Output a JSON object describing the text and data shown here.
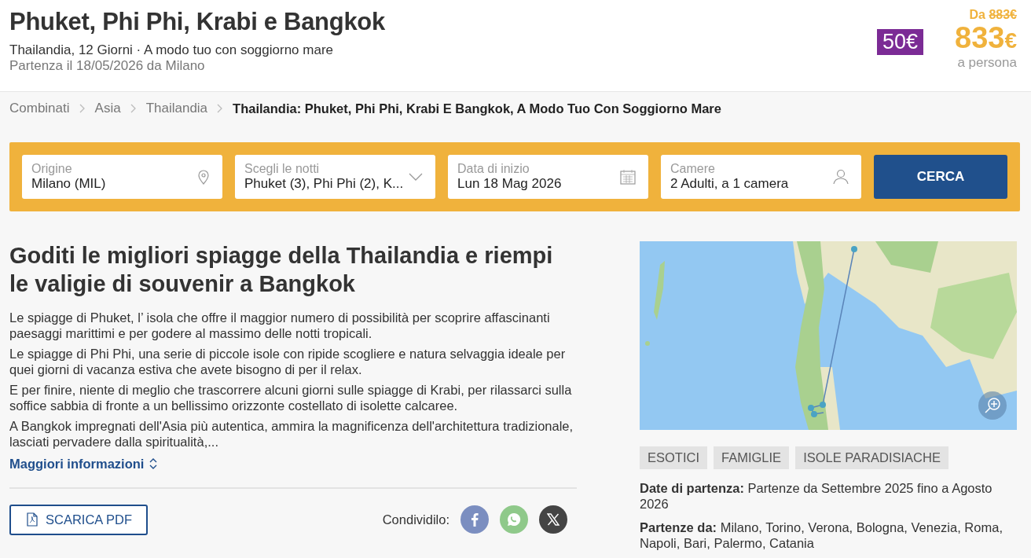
{
  "header": {
    "title": "Phuket, Phi Phi, Krabi e Bangkok",
    "subtitle": "Thailandia, 12 Giorni · A modo tuo con soggiorno mare",
    "departure": "Partenza il 18/05/2026 da Milano",
    "discount": "50€",
    "price_prefix": "Da",
    "old_price": "883€",
    "price": "833",
    "currency": "€",
    "price_note": "a persona"
  },
  "breadcrumb": [
    {
      "label": "Combinati",
      "current": false
    },
    {
      "label": "Asia",
      "current": false
    },
    {
      "label": "Thailandia",
      "current": false
    },
    {
      "label": "Thailandia: Phuket, Phi Phi, Krabi E Bangkok, A Modo Tuo Con Soggiorno Mare",
      "current": true
    }
  ],
  "search": {
    "fields": [
      {
        "label": "Origine",
        "value": "Milano (MIL)",
        "kind": "pin"
      },
      {
        "label": "Scegli le notti",
        "value": "Phuket (3), Phi Phi (2), K...",
        "kind": "dropdown"
      },
      {
        "label": "Data di inizio",
        "value": "Lun 18 Mag 2026",
        "kind": "calendar"
      },
      {
        "label": "Camere",
        "value": "2 Adulti, a 1 camera",
        "kind": "person"
      }
    ],
    "button": "CERCA"
  },
  "article": {
    "heading": "Goditi le migliori spiagge della Thailandia e riempi le valigie di souvenir a Bangkok",
    "paragraphs": [
      "Le spiagge di Phuket, l’ isola che offre il maggior numero di possibilità per scoprire affascinanti paesaggi marittimi e per godere al massimo delle notti tropicali.",
      "Le spiagge di Phi Phi, una serie di piccole isole con ripide scogliere e natura selvaggia ideale per quei giorni di vacanza estiva che avete bisogno di per il relax.",
      "E per finire, niente di meglio che trascorrere alcuni giorni sulle spiagge di Krabi, per rilassarci sulla soffice sabbia di fronte a un bellissimo orizzonte costellato di isolette calcaree.",
      "A Bangkok impregnati dell'Asia più autentica, ammira la magnificenza dell'architettura tradizionale, lasciati pervadere dalla spiritualità,..."
    ],
    "more_link": "Maggiori informazioni",
    "pdf_button": "SCARICA PDF",
    "share_label": "Condividilo:",
    "share": [
      {
        "kind": "facebook",
        "color": "#7b8ec0"
      },
      {
        "kind": "whatsapp",
        "color": "#8fc98a"
      },
      {
        "kind": "x",
        "color": "#444444"
      }
    ]
  },
  "sidebar": {
    "map": {
      "kind": "picture"
    },
    "tags": [
      "ESOTICI",
      "FAMIGLIE",
      "ISOLE PARADISIACHE"
    ],
    "details": [
      {
        "label": "Date di partenza:",
        "value": "Partenze da Settembre 2025 fino a Agosto 2026"
      },
      {
        "label": "Partenze da:",
        "value": "Milano, Torino, Verona, Bologna, Venezia, Roma, Napoli, Bari, Palermo, Catania"
      }
    ]
  }
}
